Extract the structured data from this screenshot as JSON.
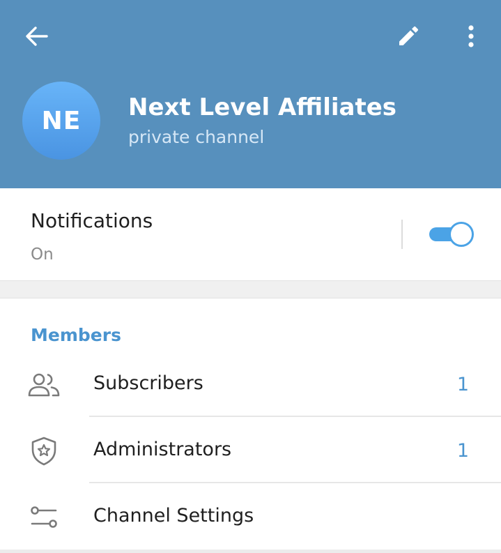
{
  "header": {
    "avatar_initials": "NE",
    "title": "Next Level Affiliates",
    "subtitle": "private channel",
    "icons": [
      "back-arrow-icon",
      "edit-pencil-icon",
      "more-vertical-icon"
    ],
    "background_color": "#5790bd"
  },
  "notifications": {
    "label": "Notifications",
    "value": "On",
    "toggle_on": true,
    "accent_color": "#4ba3e6"
  },
  "members": {
    "header": "Members",
    "items": [
      {
        "label": "Subscribers",
        "count": "1",
        "icon": "people-icon"
      },
      {
        "label": "Administrators",
        "count": "1",
        "icon": "shield-star-icon"
      },
      {
        "label": "Channel Settings",
        "count": "",
        "icon": "settings-sliders-icon"
      }
    ]
  }
}
